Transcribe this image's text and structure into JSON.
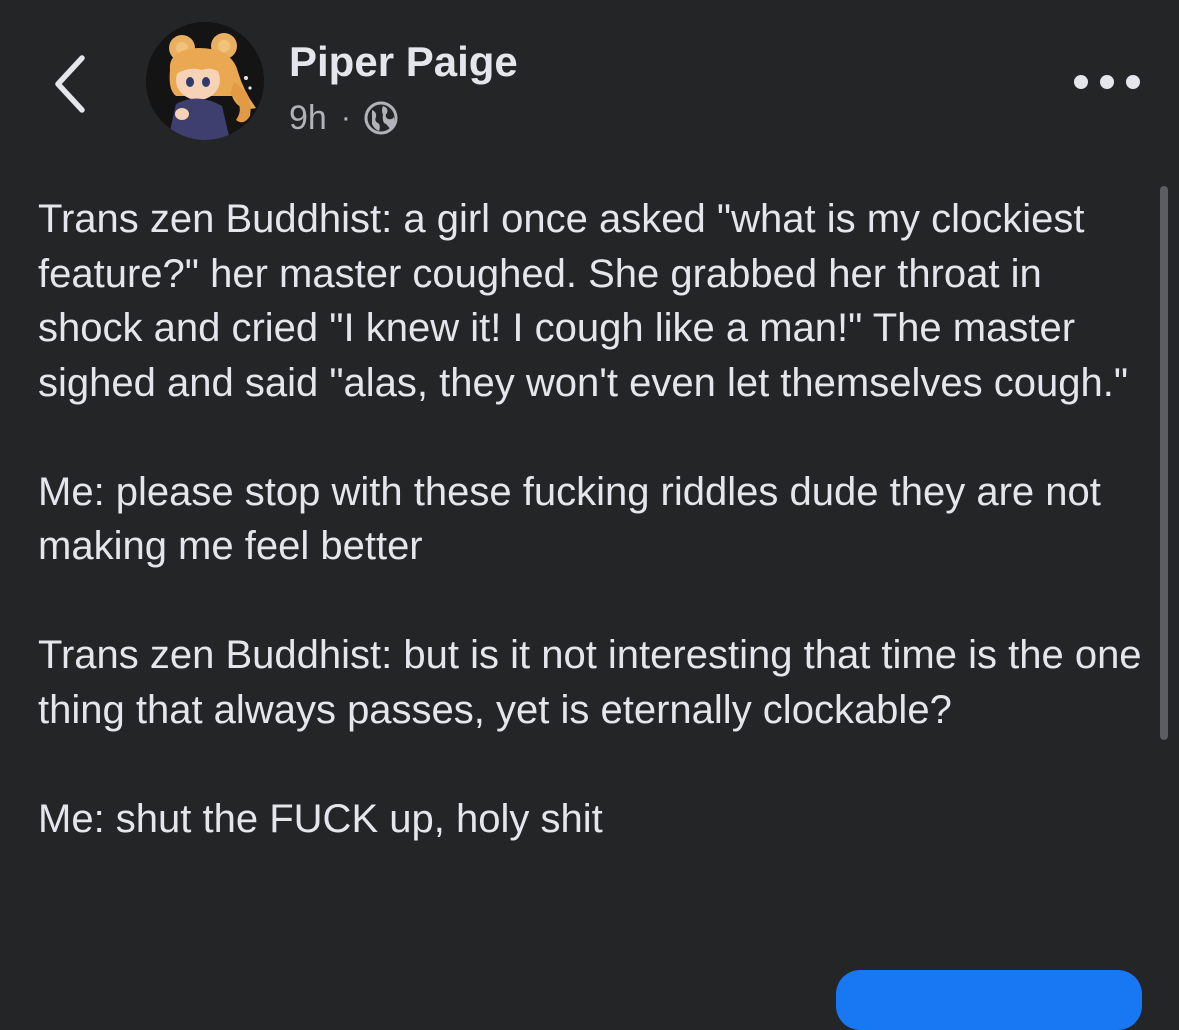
{
  "header": {
    "author_name": "Piper Paige",
    "timestamp": "9h",
    "separator": "·",
    "audience_icon": "globe-icon",
    "back_icon": "chevron-left-icon",
    "more_icon": "more-horizontal-icon"
  },
  "post": {
    "paragraphs": [
      "Trans zen Buddhist: a girl once asked \"what is my clockiest feature?\" her master coughed. She grabbed her throat in shock and cried \"I knew it! I cough like a man!\" The master sighed and said \"alas, they won't even let themselves cough.\"",
      "Me: please stop with these fucking riddles dude they are not making me feel better",
      "Trans zen Buddhist: but is it not interesting that time is the one thing that always passes, yet is eternally clockable?",
      "Me: shut the FUCK up, holy shit"
    ]
  },
  "colors": {
    "background": "#242527",
    "primary_text": "#e4e6eb",
    "secondary_text": "#b0b3b8",
    "accent": "#1877f2"
  }
}
